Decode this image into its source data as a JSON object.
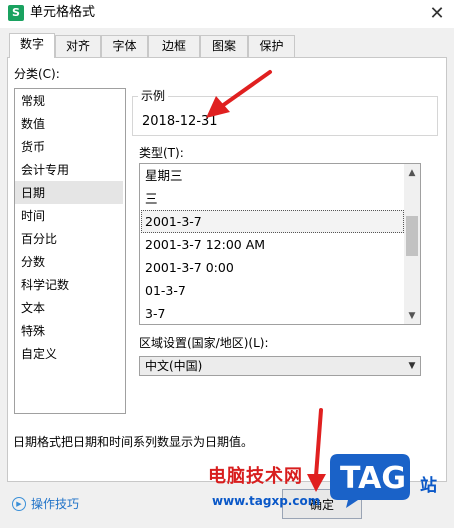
{
  "window": {
    "app_icon_letter": "S",
    "title": "单元格格式",
    "close_symbol": "✕"
  },
  "tabs": [
    {
      "label": "数字",
      "active": true
    },
    {
      "label": "对齐"
    },
    {
      "label": "字体"
    },
    {
      "label": "边框"
    },
    {
      "label": "图案"
    },
    {
      "label": "保护"
    }
  ],
  "category": {
    "label": "分类(C):",
    "items": [
      "常规",
      "数值",
      "货币",
      "会计专用",
      "日期",
      "时间",
      "百分比",
      "分数",
      "科学记数",
      "文本",
      "特殊",
      "自定义"
    ],
    "selected": "日期"
  },
  "sample": {
    "label": "示例",
    "value": "2018-12-31"
  },
  "type": {
    "label": "类型(T):",
    "items": [
      "星期三",
      "三",
      "2001-3-7",
      "2001-3-7 12:00 AM",
      "2001-3-7 0:00",
      "01-3-7",
      "3-7"
    ],
    "selected": "2001-3-7",
    "scroll_up": "▲",
    "scroll_down": "▼"
  },
  "locale": {
    "label": "区域设置(国家/地区)(L):",
    "value": "中文(中国)",
    "arrow": "▼"
  },
  "description": "日期格式把日期和时间系列数显示为日期值。",
  "footer": {
    "tips_icon": "▶",
    "tips_label": "操作技巧",
    "ok_label": "确定"
  },
  "watermark": {
    "site_name": "电脑技术网",
    "url": "www.tagxp.com",
    "logo_text": "TAG",
    "station": "站"
  },
  "colors": {
    "accent_red": "#d81e1e",
    "link_blue": "#1f72c8",
    "watermark_blue": "#0a58c8",
    "app_green": "#1aa260"
  }
}
